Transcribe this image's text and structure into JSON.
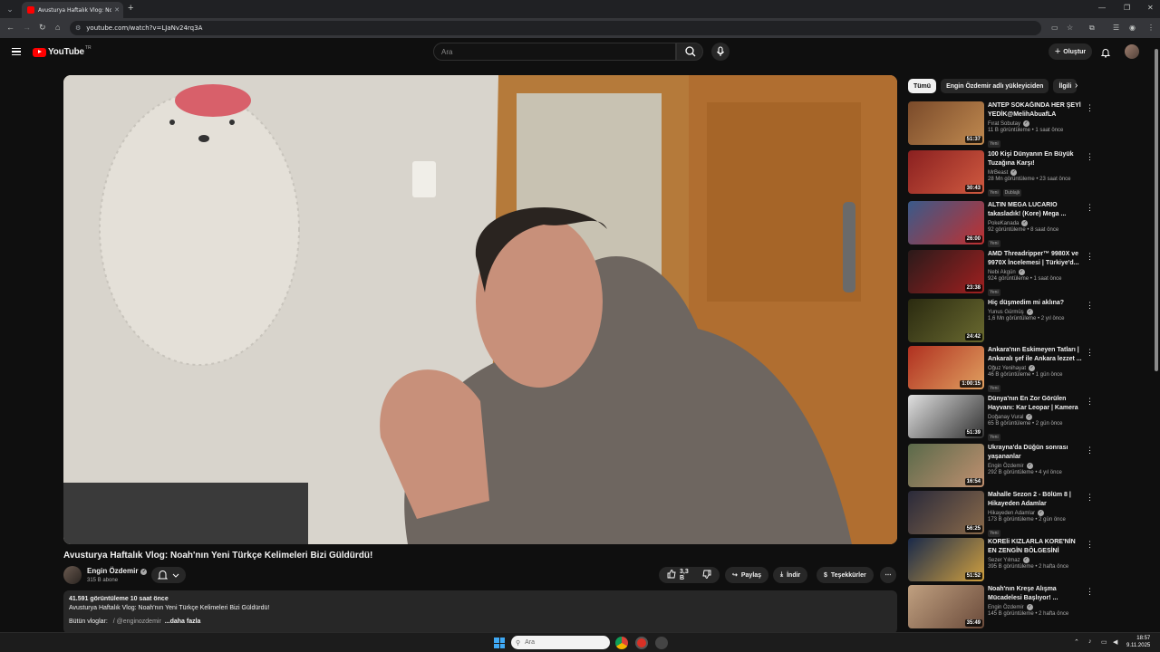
{
  "browser": {
    "tab_title": "Avusturya Haftalık Vlog: Noah'ın Yeni Türkçe Kelimeleri Bizi Güldürdü!",
    "url": "youtube.com/watch?v=LJaNv24rq3A"
  },
  "header": {
    "logo_text": "YouTube",
    "logo_country": "TR",
    "search_placeholder": "Ara",
    "create_label": "Oluştur"
  },
  "video": {
    "title": "Avusturya Haftalık Vlog: Noah'nın Yeni Türkçe Kelimeleri Bizi Güldürdü!",
    "channel": "Engin Özdemir",
    "subscribers": "315 B abone",
    "likes": "3,3 B",
    "share_label": "Paylaş",
    "download_label": "İndir",
    "thanks_label": "Teşekkürler",
    "description": {
      "stats": "41.591 görüntüleme  10 saat önce",
      "first_line": "Avusturya Haftalık Vlog: Noah'nın Yeni Türkçe Kelimeleri Bizi Güldürdü!",
      "playlist_prefix": "Bütün vloglar:",
      "playlist_link": "/ @enginozdemir",
      "more": "...daha fazla"
    }
  },
  "sidebar": {
    "chips": [
      "Tümü",
      "Engin Özdemir adlı yükleyiciden",
      "İlgili"
    ],
    "recommendations": [
      {
        "title": "ANTEP SOKAĞINDA HER ŞEYİ YEDİK@MelihAbuafLA",
        "channel": "Fırat Sobutay",
        "meta": "11 B görüntüleme • 1 saat önce",
        "duration": "51:37",
        "badges": [
          "Yeni"
        ],
        "colors": [
          "#7a4a2a",
          "#c08a50"
        ]
      },
      {
        "title": "100 Kişi Dünyanın En Büyük Tuzağına Karşı!",
        "channel": "MrBeast",
        "meta": "28 Mn görüntüleme • 23 saat önce",
        "duration": "30:43",
        "badges": [
          "Yeni",
          "Dublajlı"
        ],
        "colors": [
          "#8a2020",
          "#d05a40"
        ]
      },
      {
        "title": "ALTIN MEGA LUCARIO takasladık! (Kore) Mega ...",
        "channel": "PokeKanada",
        "meta": "92 görüntüleme • 8 saat önce",
        "duration": "26:00",
        "badges": [
          "Yeni"
        ],
        "colors": [
          "#3a5a8a",
          "#c03030"
        ]
      },
      {
        "title": "AMD Threadripper™ 9980X ve 9970X İncelemesi  |  Türkiye'd...",
        "channel": "Nebi Akgün",
        "meta": "924 görüntüleme • 1 saat önce",
        "duration": "23:38",
        "badges": [
          "Yeni"
        ],
        "colors": [
          "#2a1a1a",
          "#a02020"
        ]
      },
      {
        "title": "Hiç düşmedim mi aklına?",
        "channel": "Yunus Gürmüş",
        "meta": "1,6 Mn görüntüleme • 2 yıl önce",
        "duration": "24:42",
        "badges": [],
        "colors": [
          "#2a2a10",
          "#6a6a30"
        ]
      },
      {
        "title": "Ankara'nın Eskimeyen Tatları | Ankaralı şef ile Ankara lezzet ...",
        "channel": "Oğuz Yenihayat",
        "meta": "46 B görüntüleme • 1 gün önce",
        "duration": "1:00:15",
        "badges": [
          "Yeni"
        ],
        "colors": [
          "#b03020",
          "#e0a060"
        ]
      },
      {
        "title": "Dünya'nın En Zor Görülen Hayvanı: Kar Leopar | Kamera ...",
        "channel": "Doğanay Vural",
        "meta": "65 B görüntüleme • 2 gün önce",
        "duration": "51:39",
        "badges": [
          "Yeni"
        ],
        "colors": [
          "#e0e0e0",
          "#303030"
        ]
      },
      {
        "title": "Ukrayna'da Düğün sonrası yaşananlar",
        "channel": "Engin Özdemir",
        "meta": "292 B görüntüleme • 4 yıl önce",
        "duration": "16:54",
        "badges": [],
        "colors": [
          "#5a6a4a",
          "#c09070"
        ]
      },
      {
        "title": "Mahalle Sezon 2 - Bölüm 8 | Hikayeden Adamlar",
        "channel": "Hikayeden Adamlar",
        "meta": "173 B görüntüleme • 2 gün önce",
        "duration": "56:25",
        "badges": [
          "Yeni"
        ],
        "colors": [
          "#2a2a3a",
          "#8a6a4a"
        ]
      },
      {
        "title": "KOREli KIZLARLA KORE'NİN EN ZENGİN BÖLGESİNİ GEZDİM!",
        "channel": "Sezer Yılmaz",
        "meta": "395 B görüntüleme • 2 hafta önce",
        "duration": "51:52",
        "badges": [],
        "colors": [
          "#1a2a4a",
          "#d0a040"
        ]
      },
      {
        "title": "Noah'nın Kreşe Alışma Mücadelesi Başlıyor! ...",
        "channel": "Engin Özdemir",
        "meta": "145 B görüntüleme • 2 hafta önce",
        "duration": "35:49",
        "badges": [],
        "colors": [
          "#c0a080",
          "#6a4a3a"
        ]
      }
    ]
  },
  "taskbar": {
    "search_placeholder": "Ara",
    "time": "18:57",
    "date": "9.11.2025"
  }
}
